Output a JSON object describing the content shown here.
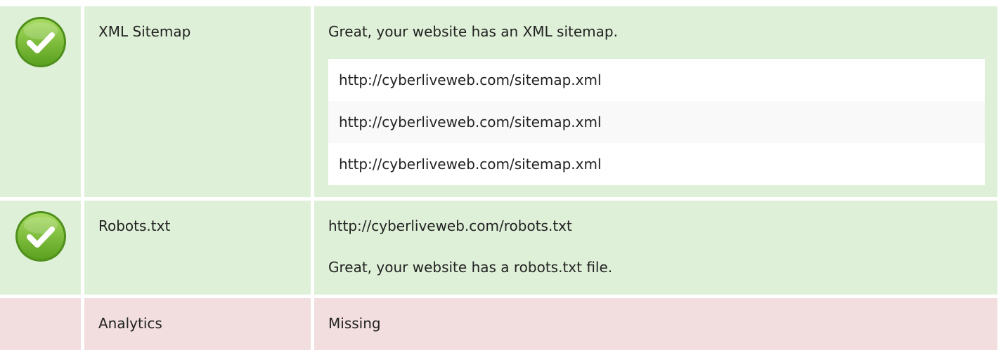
{
  "rows": [
    {
      "status": "pass",
      "icon": "check-circle-icon",
      "label": "XML Sitemap",
      "message": "Great, your website has an XML sitemap.",
      "urls": [
        "http://cyberliveweb.com/sitemap.xml",
        "http://cyberliveweb.com/sitemap.xml",
        "http://cyberliveweb.com/sitemap.xml"
      ]
    },
    {
      "status": "pass",
      "icon": "check-circle-icon",
      "label": "Robots.txt",
      "url": "http://cyberliveweb.com/robots.txt",
      "message": "Great, your website has a robots.txt file."
    },
    {
      "status": "fail",
      "label": "Analytics",
      "value": "Missing"
    }
  ],
  "colors": {
    "pass_bg": "#dff0d8",
    "fail_bg": "#f2dede",
    "check_green": "#6fb42c"
  }
}
